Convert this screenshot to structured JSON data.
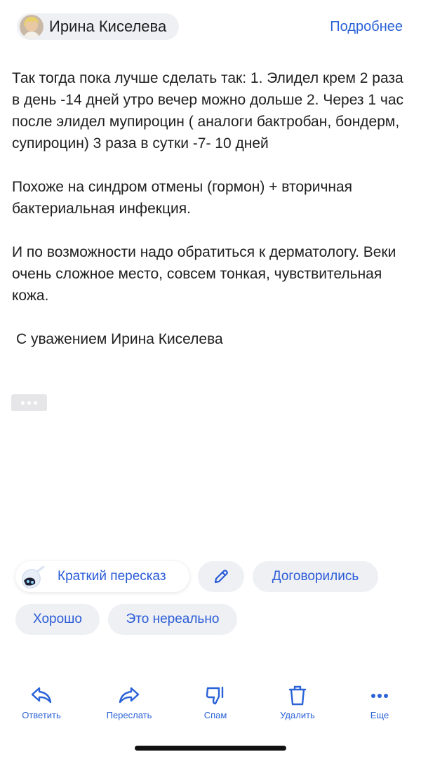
{
  "header": {
    "sender_name": "Ирина Киселева",
    "details_link": "Подробнее"
  },
  "message": {
    "paragraphs": [
      "Так тогда пока лучше сделать так: 1. Элидел крем 2 раза в день -14 дней утро вечер можно дольше 2. Через 1 час после элидел мупироцин ( аналоги бактробан, бондерм, супироцин) 3 раза в сутки -7- 10 дней",
      "Похоже на синдром отмены (гормон) + вторичная бактериальная инфекция.",
      "И по возможности надо обратиться к дерматологу. Веки очень сложное место, совсем тонкая, чувствительная кожа.",
      "С уважением Ирина Киселева"
    ]
  },
  "smart_replies": {
    "summary": "Краткий пересказ",
    "agreed": "Договорились",
    "good": "Хорошо",
    "unreal": "Это нереально"
  },
  "toolbar": {
    "reply": "Ответить",
    "forward": "Переслать",
    "spam": "Спам",
    "delete": "Удалить",
    "more": "Еще"
  },
  "icons": {
    "edit": "pencil-icon",
    "reply": "reply-icon",
    "forward": "forward-icon",
    "spam": "thumbs-down-icon",
    "delete": "trash-icon",
    "more": "more-dots-icon"
  },
  "colors": {
    "accent": "#2a62d8",
    "chip_bg": "#eef0f4"
  }
}
